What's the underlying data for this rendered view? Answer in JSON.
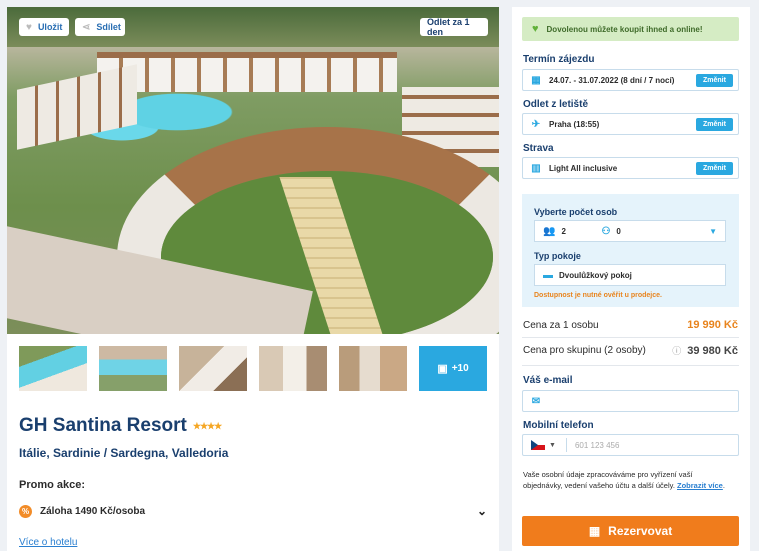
{
  "gallery": {
    "save_label": "Uložit",
    "share_label": "Sdílet",
    "departure_badge": "Odlet za 1 den",
    "more_photos": "+10"
  },
  "hotel": {
    "name": "GH Santina Resort",
    "stars": "★★★★",
    "location": "Itálie, Sardinie / Sardegna, Valledoria",
    "promo_label": "Promo akce:",
    "promo_text": "Záloha 1490 Kč/osoba",
    "more_link": "Více o hotelu"
  },
  "booking": {
    "notice": "Dovolenou můžete koupit ihned a online!",
    "term_label": "Termín zájezdu",
    "term_value": "24.07. - 31.07.2022 (8 dní / 7 nocí)",
    "airport_label": "Odlet z letiště",
    "airport_value": "Praha (18:55)",
    "board_label": "Strava",
    "board_value": "Light All inclusive",
    "change_label": "Změnit",
    "persons_label": "Vyberte počet osob",
    "adults": "2",
    "children": "0",
    "room_label": "Typ pokoje",
    "room_value": "Dvoulůžkový pokoj",
    "availability": "Dostupnost je nutné ověřit u prodejce.",
    "price_per_person_label": "Cena za 1 osobu",
    "price_per_person": "19 990 Kč",
    "price_group_label": "Cena pro skupinu (2 osoby)",
    "price_group": "39 980 Kč",
    "email_label": "Váš e-mail",
    "phone_label": "Mobilní telefon",
    "phone_placeholder": "601 123 456",
    "gdpr_text": "Vaše osobní údaje zpracováváme pro vyřízení vaší objednávky, vedení vašeho účtu a další účely.",
    "gdpr_link": "Zobrazit více",
    "reserve_label": "Rezervovat"
  }
}
